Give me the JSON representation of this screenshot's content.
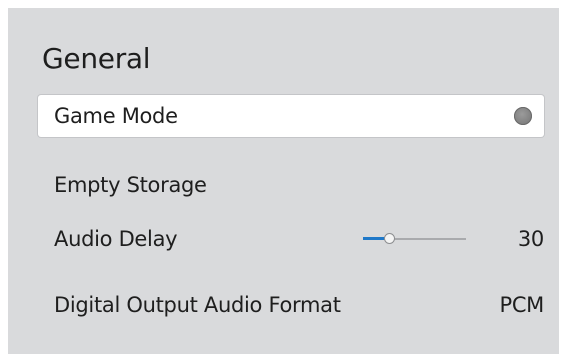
{
  "panel": {
    "title": "General",
    "items": [
      {
        "label": "Game Mode",
        "toggle_state": "off",
        "icon": "toggle-off-icon"
      },
      {
        "label": "Empty Storage"
      },
      {
        "label": "Audio Delay",
        "value": "30",
        "slider_level_fraction": 0.25
      },
      {
        "label": "Digital Output Audio Format",
        "value": "PCM"
      }
    ]
  },
  "colors": {
    "panel_background": "#d9dadc",
    "focused_background": "#ffffff",
    "slider_fill": "#1f78c8",
    "text": "#1e1e1e"
  }
}
